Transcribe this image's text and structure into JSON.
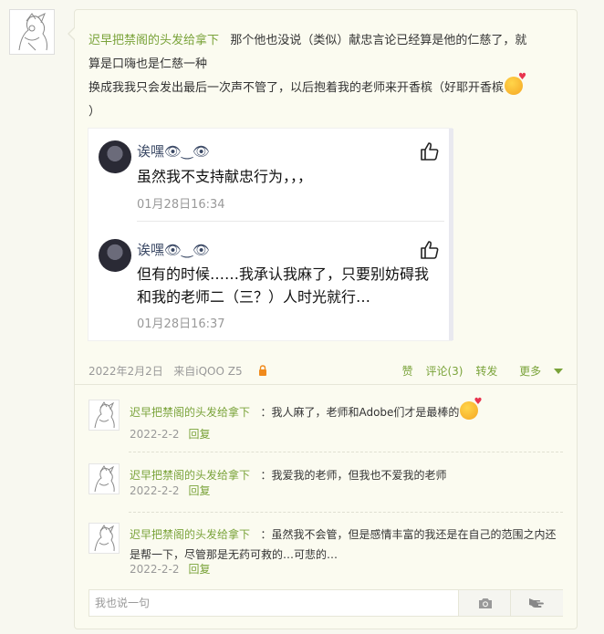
{
  "post": {
    "author": "迟早把禁阁的头发给拿下",
    "text_line1": "那个他也没说（类似）献忠言论已经算是他的仁慈了，就",
    "text_line2": "算是口嗨也是仁慈一种",
    "text_line3": "换成我我只会发出最后一次声不管了，以后抱着我的老师来开香槟（好耶开香槟",
    "text_line4": "）"
  },
  "screenshot_comments": [
    {
      "name": "诶嘿👁‿👁",
      "text": "虽然我不支持献忠行为，，，",
      "time": "01月28日16:34"
    },
    {
      "name": "诶嘿👁‿👁",
      "text": "但有的时候……我承认我麻了，只要别妨碍我和我的老师二（三？）人时光就行…",
      "time": "01月28日16:37"
    }
  ],
  "meta": {
    "date": "2022年2月2日",
    "source": "来自iQOO Z5",
    "like": "赞",
    "comment": "评论(3)",
    "repost": "转发",
    "more": "更多"
  },
  "comments": [
    {
      "author": "迟早把禁阁的头发给拿下",
      "text": "：我人麻了，老师和Adobe们才是最棒的",
      "date": "2022-2-2",
      "reply": "回复"
    },
    {
      "author": "迟早把禁阁的头发给拿下",
      "text": "：我爱我的老师，但我也不爱我的老师",
      "date": "2022-2-2",
      "reply": "回复"
    },
    {
      "author": "迟早把禁阁的头发给拿下",
      "text": "：虽然我不会管，但是感情丰富的我还是在自己的范围之内还是帮一下，尽管那是无药可救的…可悲的…",
      "date": "2022-2-2",
      "reply": "回复"
    }
  ],
  "input": {
    "placeholder": "我也说一句"
  },
  "icons": {
    "avatar": "sketch-avatar-icon",
    "emoji": "smiling-face-with-hearts-icon",
    "like": "thumbs-up-icon",
    "lock": "lock-icon",
    "camera": "camera-icon",
    "send": "hand-point-icon",
    "more": "caret-down-icon"
  },
  "colors": {
    "accent_green": "#7aa33a",
    "lock_orange": "#f08a1c",
    "background": "#f8f8f0"
  }
}
